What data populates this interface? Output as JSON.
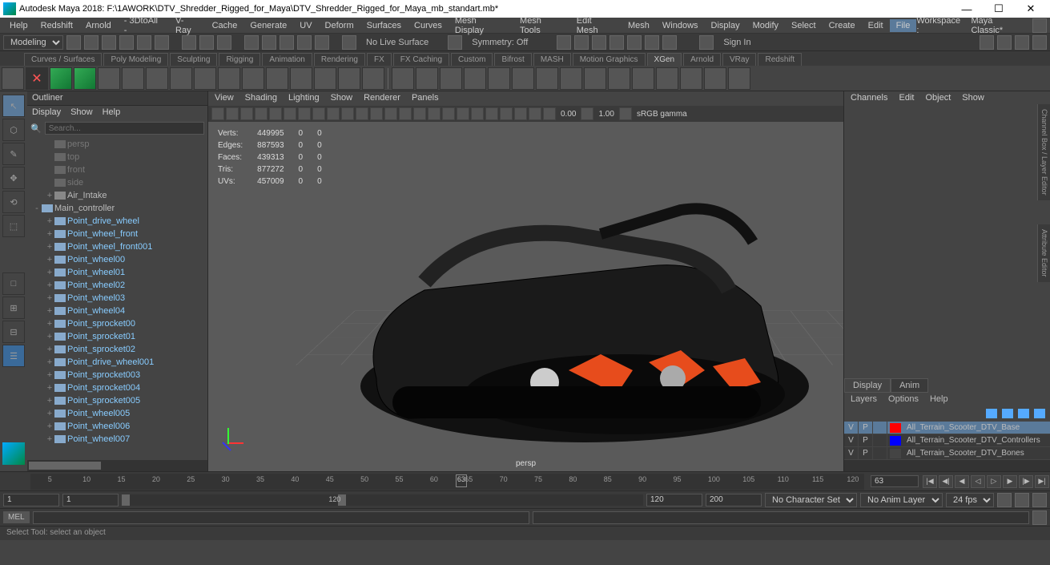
{
  "title": "Autodesk Maya 2018: F:\\1AWORK\\DTV_Shredder_Rigged_for_Maya\\DTV_Shredder_Rigged_for_Maya_mb_standart.mb*",
  "menus": [
    "File",
    "Edit",
    "Create",
    "Select",
    "Modify",
    "Display",
    "Windows",
    "Mesh",
    "Edit Mesh",
    "Mesh Tools",
    "Mesh Display",
    "Curves",
    "Surfaces",
    "Deform",
    "UV",
    "Generate",
    "Cache",
    "V-Ray",
    "- 3DtoAll -",
    "Arnold",
    "Redshift",
    "Help"
  ],
  "workspace_label": "Workspace :",
  "workspace_value": "Maya Classic*",
  "statusline": {
    "mode": "Modeling",
    "nolive": "No Live Surface",
    "symmetry": "Symmetry: Off",
    "signin": "Sign In"
  },
  "shelf_tabs": [
    "Curves / Surfaces",
    "Poly Modeling",
    "Sculpting",
    "Rigging",
    "Animation",
    "Rendering",
    "FX",
    "FX Caching",
    "Custom",
    "Bifrost",
    "MASH",
    "Motion Graphics",
    "XGen",
    "Arnold",
    "VRay",
    "Redshift"
  ],
  "shelf_active": "XGen",
  "outliner": {
    "title": "Outliner",
    "menus": [
      "Display",
      "Show",
      "Help"
    ],
    "search_ph": "Search...",
    "items": [
      {
        "label": "persp",
        "t": "cam",
        "dim": true,
        "ind": 1
      },
      {
        "label": "top",
        "t": "cam",
        "dim": true,
        "ind": 1
      },
      {
        "label": "front",
        "t": "cam",
        "dim": true,
        "ind": 1
      },
      {
        "label": "side",
        "t": "cam",
        "dim": true,
        "ind": 1
      },
      {
        "label": "Air_Intake",
        "t": "mesh",
        "ind": 1,
        "exp": "+"
      },
      {
        "label": "Main_controller",
        "t": "ctrl",
        "ind": 0,
        "exp": "-"
      },
      {
        "label": "Point_drive_wheel",
        "t": "ctrl",
        "ind": 1,
        "exp": "+",
        "sel": true
      },
      {
        "label": "Point_wheel_front",
        "t": "ctrl",
        "ind": 1,
        "exp": "+",
        "sel": true
      },
      {
        "label": "Point_wheel_front001",
        "t": "ctrl",
        "ind": 1,
        "exp": "+",
        "sel": true
      },
      {
        "label": "Point_wheel00",
        "t": "ctrl",
        "ind": 1,
        "exp": "+",
        "sel": true
      },
      {
        "label": "Point_wheel01",
        "t": "ctrl",
        "ind": 1,
        "exp": "+",
        "sel": true
      },
      {
        "label": "Point_wheel02",
        "t": "ctrl",
        "ind": 1,
        "exp": "+",
        "sel": true
      },
      {
        "label": "Point_wheel03",
        "t": "ctrl",
        "ind": 1,
        "exp": "+",
        "sel": true
      },
      {
        "label": "Point_wheel04",
        "t": "ctrl",
        "ind": 1,
        "exp": "+",
        "sel": true
      },
      {
        "label": "Point_sprocket00",
        "t": "ctrl",
        "ind": 1,
        "exp": "+",
        "sel": true
      },
      {
        "label": "Point_sprocket01",
        "t": "ctrl",
        "ind": 1,
        "exp": "+",
        "sel": true
      },
      {
        "label": "Point_sprocket02",
        "t": "ctrl",
        "ind": 1,
        "exp": "+",
        "sel": true
      },
      {
        "label": "Point_drive_wheel001",
        "t": "ctrl",
        "ind": 1,
        "exp": "+",
        "sel": true
      },
      {
        "label": "Point_sprocket003",
        "t": "ctrl",
        "ind": 1,
        "exp": "+",
        "sel": true
      },
      {
        "label": "Point_sprocket004",
        "t": "ctrl",
        "ind": 1,
        "exp": "+",
        "sel": true
      },
      {
        "label": "Point_sprocket005",
        "t": "ctrl",
        "ind": 1,
        "exp": "+",
        "sel": true
      },
      {
        "label": "Point_wheel005",
        "t": "ctrl",
        "ind": 1,
        "exp": "+",
        "sel": true
      },
      {
        "label": "Point_wheel006",
        "t": "ctrl",
        "ind": 1,
        "exp": "+",
        "sel": true
      },
      {
        "label": "Point_wheel007",
        "t": "ctrl",
        "ind": 1,
        "exp": "+",
        "sel": true
      }
    ]
  },
  "viewport": {
    "menus": [
      "View",
      "Shading",
      "Lighting",
      "Show",
      "Renderer",
      "Panels"
    ],
    "num1": "0.00",
    "num2": "1.00",
    "gamma": "sRGB gamma",
    "camera": "persp",
    "hud": [
      [
        "Verts:",
        "449995",
        "0",
        "0"
      ],
      [
        "Edges:",
        "887593",
        "0",
        "0"
      ],
      [
        "Faces:",
        "439313",
        "0",
        "0"
      ],
      [
        "Tris:",
        "877272",
        "0",
        "0"
      ],
      [
        "UVs:",
        "457009",
        "0",
        "0"
      ]
    ]
  },
  "channelbox": {
    "menus": [
      "Channels",
      "Edit",
      "Object",
      "Show"
    ],
    "tabs": [
      "Display",
      "Anim"
    ],
    "tab_active": "Display",
    "lmenus": [
      "Layers",
      "Options",
      "Help"
    ],
    "layers": [
      {
        "v": "V",
        "p": "P",
        "color": "#f00",
        "name": "All_Terrain_Scooter_DTV_Base",
        "hl": true
      },
      {
        "v": "V",
        "p": "P",
        "color": "#00f",
        "name": "All_Terrain_Scooter_DTV_Controllers"
      },
      {
        "v": "V",
        "p": "P",
        "color": "",
        "name": "All_Terrain_Scooter_DTV_Bones"
      }
    ]
  },
  "right_tabs": [
    "Channel Box / Layer Editor",
    "Attribute Editor"
  ],
  "timeline": {
    "ticks": [
      "5",
      "10",
      "15",
      "20",
      "25",
      "30",
      "35",
      "40",
      "45",
      "50",
      "55",
      "60",
      "65",
      "70",
      "75",
      "80",
      "85",
      "90",
      "95",
      "100",
      "105",
      "110",
      "115",
      "120"
    ],
    "current": "63",
    "current_field": "63"
  },
  "range": {
    "start_out": "1",
    "start_in": "1",
    "end_in": "120",
    "end_out": "120",
    "playback": "200",
    "charset": "No Character Set",
    "animlayer": "No Anim Layer",
    "fps": "24 fps"
  },
  "cmd": {
    "lang": "MEL"
  },
  "help": "Select Tool: select an object"
}
